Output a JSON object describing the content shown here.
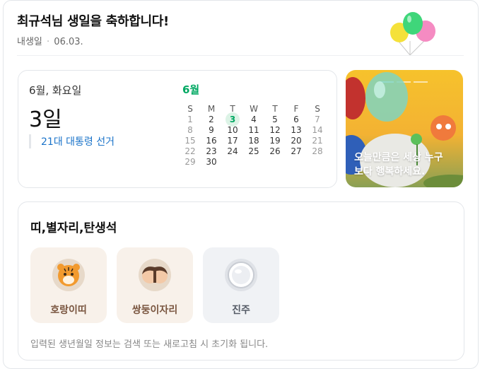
{
  "header": {
    "title": "최규석님 생일을 축하합니다!",
    "sub_label": "내생일",
    "sub_date": "06.03."
  },
  "date_card": {
    "weekday_label": "6월, 화요일",
    "day_number": "3",
    "day_suffix": "일",
    "event": "21대 대통령 선거"
  },
  "calendar": {
    "month": "6월",
    "weekdays": [
      "S",
      "M",
      "T",
      "W",
      "T",
      "F",
      "S"
    ],
    "today": "3",
    "rows": [
      [
        "1",
        "2",
        "3",
        "4",
        "5",
        "6",
        "7"
      ],
      [
        "8",
        "9",
        "10",
        "11",
        "12",
        "13",
        "14"
      ],
      [
        "15",
        "16",
        "17",
        "18",
        "19",
        "20",
        "21"
      ],
      [
        "22",
        "23",
        "24",
        "25",
        "26",
        "27",
        "28"
      ],
      [
        "29",
        "30",
        "",
        "",
        "",
        "",
        ""
      ]
    ]
  },
  "promo": {
    "line1": "오늘만큼은 세상 누구",
    "line2": "보다 행복하세요."
  },
  "zodiac": {
    "title": "띠,별자리,탄생석",
    "items": [
      {
        "label": "호랑이띠",
        "icon": "tiger-icon"
      },
      {
        "label": "쌍둥이자리",
        "icon": "twins-icon"
      },
      {
        "label": "진주",
        "icon": "pearl-icon"
      }
    ],
    "note": "입력된 생년월일 정보는 검색 또는 새로고침 시 초기화 됩니다."
  },
  "colors": {
    "accent_green": "#00a862",
    "link_blue": "#1a73c9"
  }
}
